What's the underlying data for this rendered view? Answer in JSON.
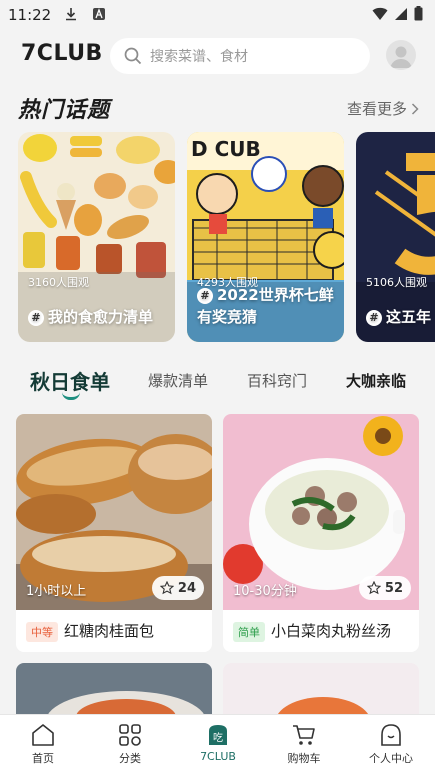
{
  "status_bar": {
    "time": "11:22"
  },
  "header": {
    "logo": "7CLUB",
    "search_placeholder": "搜索菜谱、食材"
  },
  "hot_topics": {
    "title": "热门话题",
    "see_more": "查看更多",
    "items": [
      {
        "views": "3160人围观",
        "title": "我的食愈力清单"
      },
      {
        "views": "4293人围观",
        "title": "2022世界杯七鲜有奖竞猜"
      },
      {
        "views": "5106人围观",
        "title": "这五年"
      }
    ]
  },
  "tabs": [
    "秋日食单",
    "爆款清单",
    "百科窍门",
    "大咖亲临"
  ],
  "recipes": [
    {
      "duration": "1小时以上",
      "likes": "24",
      "difficulty": "中等",
      "name": "红糖肉桂面包"
    },
    {
      "duration": "10-30分钟",
      "likes": "52",
      "difficulty": "简单",
      "name": "小白菜肉丸粉丝汤"
    }
  ],
  "colors": {
    "accent": "#1e8f80",
    "medium_tag": "#e8603c",
    "easy_tag": "#2e9e4c"
  },
  "nav": [
    {
      "label": "首页",
      "icon": "home-icon"
    },
    {
      "label": "分类",
      "icon": "category-icon"
    },
    {
      "label": "7CLUB",
      "icon": "club-icon"
    },
    {
      "label": "购物车",
      "icon": "cart-icon"
    },
    {
      "label": "个人中心",
      "icon": "profile-icon"
    }
  ]
}
